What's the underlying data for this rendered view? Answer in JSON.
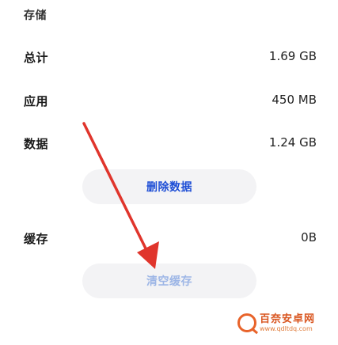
{
  "section_header": "存储",
  "rows": [
    {
      "label": "总计",
      "value": "1.69 GB"
    },
    {
      "label": "应用",
      "value": "450 MB"
    },
    {
      "label": "数据",
      "value": "1.24 GB"
    }
  ],
  "delete_data_button": "删除数据",
  "cache": {
    "label": "缓存",
    "value": "0B"
  },
  "clear_cache_button": "清空缓存",
  "colors": {
    "accent_blue": "#1f4fd6",
    "disabled_blue": "#9db6e6",
    "arrow_red": "#e0352c",
    "pill_bg": "#f3f3f5"
  },
  "watermark": {
    "title": "百奈安卓网",
    "url": "www.qdltdq.com"
  }
}
